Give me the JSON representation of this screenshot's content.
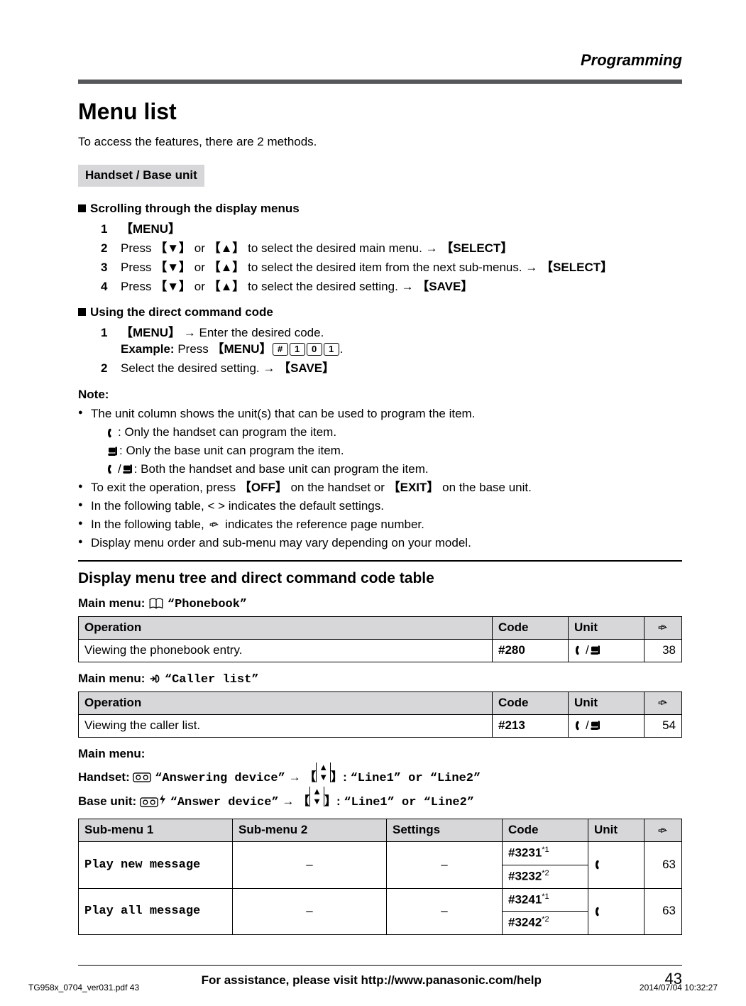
{
  "header": {
    "section": "Programming"
  },
  "title": "Menu list",
  "intro": "To access the features, there are 2 methods.",
  "section_label": "Handset / Base unit",
  "scroll": {
    "heading": "Scrolling through the display menus",
    "steps": [
      {
        "n": "1",
        "body_parts": [
          "",
          "MENU",
          ""
        ]
      },
      {
        "n": "2",
        "prefix": "Press ",
        "k1": "▼",
        "mid1": " or ",
        "k2": "▲",
        "mid2": " to select the desired main menu. → ",
        "k3": "SELECT"
      },
      {
        "n": "3",
        "prefix": "Press ",
        "k1": "▼",
        "mid1": " or ",
        "k2": "▲",
        "mid2": " to select the desired item from the next sub-menus. → ",
        "k3": "SELECT"
      },
      {
        "n": "4",
        "prefix": "Press ",
        "k1": "▼",
        "mid1": " or ",
        "k2": "▲",
        "mid2": " to select the desired setting. → ",
        "k3": "SAVE"
      }
    ]
  },
  "direct": {
    "heading": "Using the direct command code",
    "steps": [
      {
        "n": "1",
        "line1_k": "MENU",
        "line1_rest": " → Enter the desired code.",
        "ex_label": "Example:",
        "ex_press": " Press ",
        "ex_menu": "MENU",
        "ex_keys": [
          "#",
          "1",
          "0",
          "1"
        ],
        "ex_period": "."
      },
      {
        "n": "2",
        "text": "Select the desired setting. → ",
        "k": "SAVE"
      }
    ]
  },
  "note": {
    "label": "Note:",
    "b1": "The unit column shows the unit(s) that can be used to program the item.",
    "b1a": ": Only the handset can program the item.",
    "b1b": ": Only the base unit can program the item.",
    "b1c": ": Both the handset and base unit can program the item.",
    "b2_pre": "To exit the operation, press ",
    "b2_k1": "OFF",
    "b2_mid": " on the handset or ",
    "b2_k2": "EXIT",
    "b2_post": " on the base unit.",
    "b3": "In the following table, < > indicates the default settings.",
    "b4_pre": "In the following table, ",
    "b4_post": " indicates the reference page number.",
    "b5": "Display menu order and sub-menu may vary depending on your model."
  },
  "subtitle": "Display menu tree and direct command code table",
  "mm1": {
    "label": "Main menu: ",
    "name": "“Phonebook”"
  },
  "table1": {
    "h_op": "Operation",
    "h_code": "Code",
    "h_unit": "Unit",
    "r1_op": "Viewing the phonebook entry.",
    "r1_code": "#280",
    "r1_page": "38"
  },
  "mm2": {
    "label": "Main menu: ",
    "name": "“Caller list”"
  },
  "table2": {
    "h_op": "Operation",
    "h_code": "Code",
    "h_unit": "Unit",
    "r1_op": "Viewing the caller list.",
    "r1_code": "#213",
    "r1_page": "54"
  },
  "mm3": {
    "label": "Main menu:",
    "hs_pre": "Handset: ",
    "hs_name": "“Answering device”",
    "hs_arrow": " → ",
    "hs_opts": "“Line1” or “Line2”",
    "bu_pre": "Base unit: ",
    "bu_name": "“Answer device”",
    "bu_arrow": " → ",
    "bu_opts": "“Line1” or “Line2”"
  },
  "table3": {
    "h_sm1": "Sub-menu 1",
    "h_sm2": "Sub-menu 2",
    "h_set": "Settings",
    "h_code": "Code",
    "h_unit": "Unit",
    "rows": [
      {
        "sm1": "Play new message",
        "code": "#3231",
        "sup": "*1",
        "page": "63",
        "code2": "#3232",
        "sup2": "*2"
      },
      {
        "sm1": "Play all message",
        "code": "#3241",
        "sup": "*1",
        "page": "63",
        "code2": "#3242",
        "sup2": "*2"
      }
    ]
  },
  "footer": {
    "text": "For assistance, please visit http://www.panasonic.com/help",
    "page": "43"
  },
  "bottom": {
    "left": "TG958x_0704_ver031.pdf   43",
    "right": "2014/07/04   10:32:27"
  }
}
